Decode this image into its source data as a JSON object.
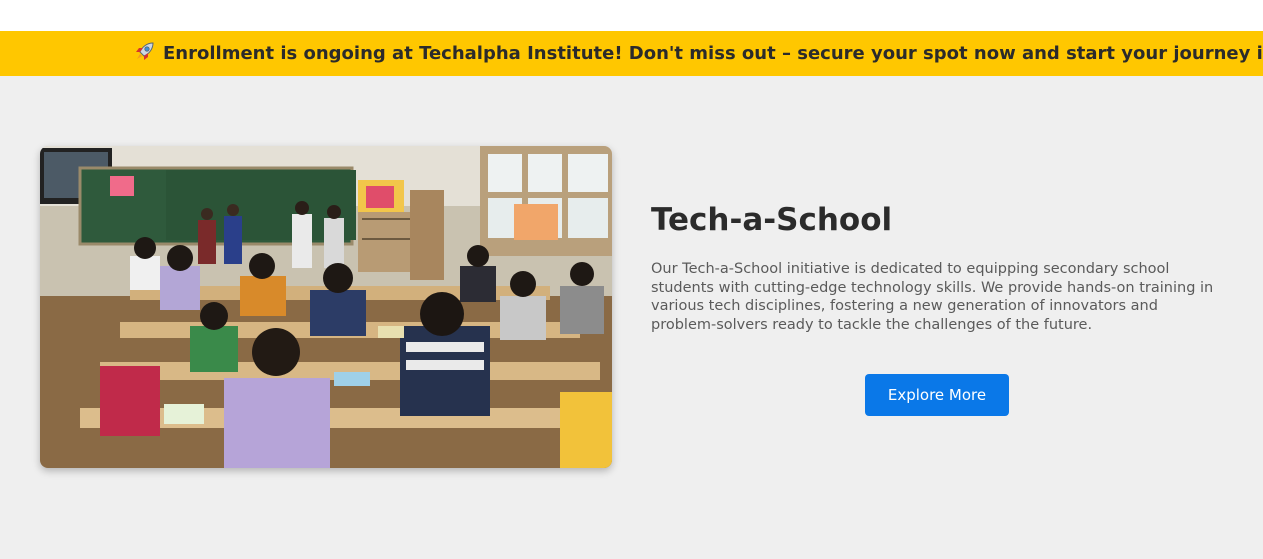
{
  "ticker": {
    "icon": "rocket-icon",
    "text": "Enrollment is ongoing at Techalpha Institute! Don't miss out – secure your spot now and start your journey into tech today!"
  },
  "feature": {
    "image": {
      "icon": "classroom-photo"
    },
    "title": "Tech-a-School",
    "description": "Our Tech-a-School initiative is dedicated to equipping secondary school students with cutting-edge technology skills. We provide hands-on training in various tech disciplines, fostering a new generation of innovators and problem-solvers ready to tackle the challenges of the future.",
    "button_label": "Explore More"
  },
  "colors": {
    "ticker_bg": "#ffc700",
    "section_bg": "#efefef",
    "button_bg": "#0a78e8",
    "title_text": "#2b2b2b"
  }
}
